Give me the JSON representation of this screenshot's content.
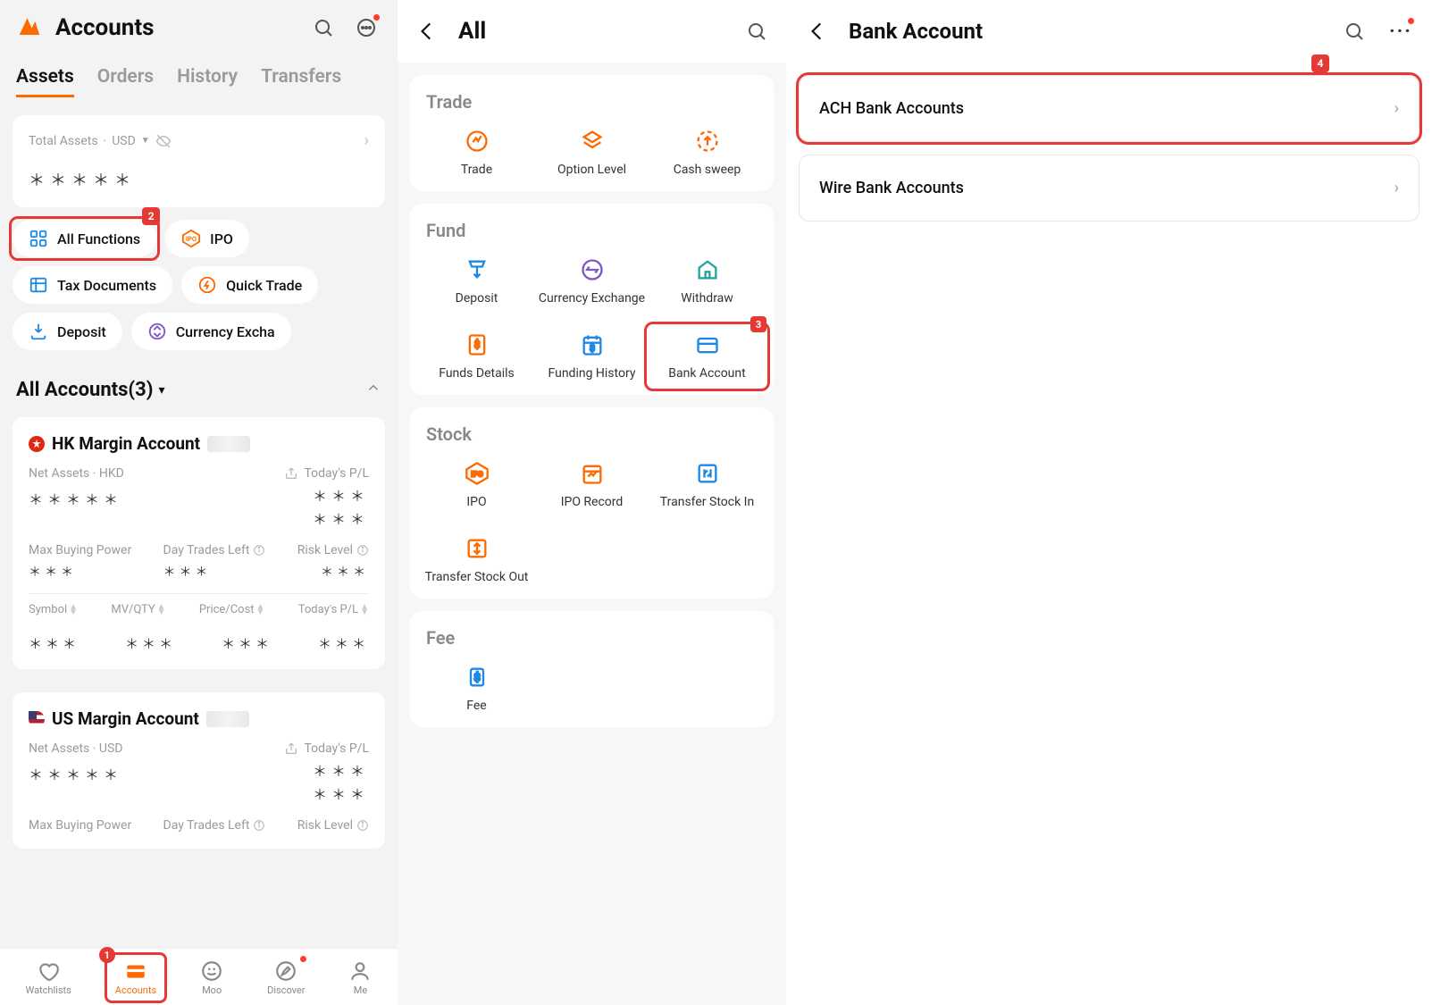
{
  "panel1": {
    "title": "Accounts",
    "tabs": [
      "Assets",
      "Orders",
      "History",
      "Transfers"
    ],
    "activeTab": 0,
    "assets": {
      "label": "Total Assets",
      "currency": "USD",
      "masked": "＊＊＊＊＊"
    },
    "chips": [
      {
        "label": "All Functions",
        "icon": "grid",
        "color": "blue"
      },
      {
        "label": "IPO",
        "icon": "ipo",
        "color": "orange"
      },
      {
        "label": "Tax Documents",
        "icon": "table",
        "color": "blue"
      },
      {
        "label": "Quick Trade",
        "icon": "bolt",
        "color": "orange"
      },
      {
        "label": "Deposit",
        "icon": "deposit",
        "color": "blue"
      },
      {
        "label": "Currency Excha",
        "icon": "exchange",
        "color": "purple"
      }
    ],
    "stepBadges": {
      "allFunctions": "2",
      "bottomNav": "1"
    },
    "accountsHeader": "All Accounts(3)",
    "accounts": [
      {
        "flag": "hk",
        "name": "HK Margin Account",
        "netAssetsLabel": "Net Assets · HKD",
        "todaysPL": "Today's P/L",
        "masked5": "＊＊＊＊＊",
        "masked3": "＊＊＊",
        "stats": [
          {
            "label": "Max Buying Power",
            "value": "＊＊＊"
          },
          {
            "label": "Day Trades Left",
            "value": "＊＊＊",
            "info": true
          },
          {
            "label": "Risk Level",
            "value": "＊＊＊",
            "info": true
          }
        ],
        "tableHead": [
          "Symbol",
          "MV/QTY",
          "Price/Cost",
          "Today's P/L"
        ],
        "tableRow": [
          "＊＊＊",
          "＊＊＊",
          "＊＊＊",
          "＊＊＊"
        ]
      },
      {
        "flag": "us",
        "name": "US Margin Account",
        "netAssetsLabel": "Net Assets · USD",
        "todaysPL": "Today's P/L",
        "masked5": "＊＊＊＊＊",
        "masked3": "＊＊＊",
        "stats": [
          {
            "label": "Max Buying Power",
            "value": ""
          },
          {
            "label": "Day Trades Left",
            "value": "",
            "info": true
          },
          {
            "label": "Risk Level",
            "value": "",
            "info": true
          }
        ]
      }
    ],
    "bottomNav": [
      {
        "label": "Watchlists",
        "icon": "heart"
      },
      {
        "label": "Accounts",
        "icon": "wallet",
        "active": true
      },
      {
        "label": "Moo",
        "icon": "moo"
      },
      {
        "label": "Discover",
        "icon": "compass",
        "dot": true
      },
      {
        "label": "Me",
        "icon": "person"
      }
    ]
  },
  "panel2": {
    "title": "All",
    "sections": [
      {
        "title": "Trade",
        "items": [
          {
            "label": "Trade",
            "icon": "trade",
            "color": "orange"
          },
          {
            "label": "Option Level",
            "icon": "option",
            "color": "orange"
          },
          {
            "label": "Cash sweep",
            "icon": "cashsweep",
            "color": "orange"
          }
        ]
      },
      {
        "title": "Fund",
        "items": [
          {
            "label": "Deposit",
            "icon": "deposit",
            "color": "blue"
          },
          {
            "label": "Currency Exchange",
            "icon": "exchange",
            "color": "purple"
          },
          {
            "label": "Withdraw",
            "icon": "withdraw",
            "color": "green"
          },
          {
            "label": "Funds Details",
            "icon": "fundsdetails",
            "color": "orange"
          },
          {
            "label": "Funding History",
            "icon": "fundinghistory",
            "color": "blue"
          },
          {
            "label": "Bank Account",
            "icon": "bankaccount",
            "color": "blue",
            "step": "3"
          }
        ]
      },
      {
        "title": "Stock",
        "items": [
          {
            "label": "IPO",
            "icon": "ipo",
            "color": "orange"
          },
          {
            "label": "IPO Record",
            "icon": "iporecord",
            "color": "orange"
          },
          {
            "label": "Transfer Stock In",
            "icon": "stockin",
            "color": "blue"
          },
          {
            "label": "Transfer Stock Out",
            "icon": "stockout",
            "color": "orange"
          }
        ]
      },
      {
        "title": "Fee",
        "items": [
          {
            "label": "Fee",
            "icon": "fee",
            "color": "blue"
          }
        ]
      }
    ]
  },
  "panel3": {
    "title": "Bank Account",
    "step": "4",
    "rows": [
      {
        "label": "ACH Bank Accounts"
      },
      {
        "label": "Wire Bank Accounts"
      }
    ]
  }
}
